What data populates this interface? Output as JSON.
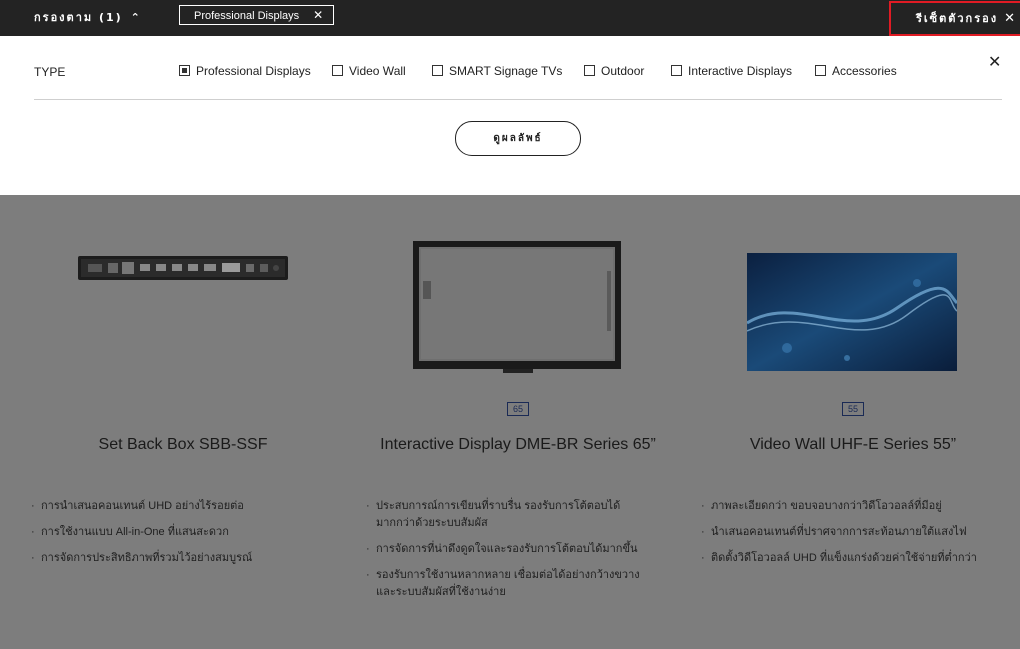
{
  "topbar": {
    "filter_toggle_label": "กรองตาม (1)",
    "active_chip_label": "Professional Displays",
    "reset_label": "รีเซ็ตตัวกรอง"
  },
  "filter": {
    "type_label": "TYPE",
    "options": [
      {
        "label": "Professional Displays",
        "checked": true
      },
      {
        "label": "Video Wall",
        "checked": false
      },
      {
        "label": "SMART Signage TVs",
        "checked": false
      },
      {
        "label": "Outdoor",
        "checked": false
      },
      {
        "label": "Interactive Displays",
        "checked": false
      },
      {
        "label": "Accessories",
        "checked": false
      }
    ],
    "view_results_label": "ดูผลลัพธ์"
  },
  "products": [
    {
      "title": "Set Back Box SBB-SSF",
      "size": "",
      "features": [
        "การนำเสนอคอนเทนต์ UHD อย่างไร้รอยต่อ",
        "การใช้งานแบบ All-in-One ที่แสนสะดวก",
        "การจัดการประสิทธิภาพที่รวมไว้อย่างสมบูรณ์"
      ]
    },
    {
      "title": "Interactive Display DME-BR Series 65”",
      "size": "65",
      "features": [
        "ประสบการณ์การเขียนที่ราบรื่น รองรับการโต้ตอบได้มากกว่าด้วยระบบสัมผัส",
        "การจัดการที่น่าดึงดูดใจและรองรับการโต้ตอบได้มากขึ้น",
        "รองรับการใช้งานหลากหลาย เชื่อมต่อได้อย่างกว้างขวาง และระบบสัมผัสที่ใช้งานง่าย"
      ]
    },
    {
      "title": "Video Wall UHF-E Series 55”",
      "size": "55",
      "features": [
        "ภาพละเอียดกว่า ขอบจอบางกว่าวิดีโอวอลล์ที่มีอยู่",
        "นำเสนอคอนเทนต์ที่ปราศจากการสะท้อนภายใต้แสงไฟ",
        "ติดตั้งวิดีโอวอลล์ UHD ที่แข็งแกร่งด้วยค่าใช้จ่ายที่ต่ำกว่า"
      ]
    }
  ],
  "colors": {
    "topbar_bg": "#232323",
    "reset_border": "#e01b24",
    "overlay_bg": "#7d7d7d"
  }
}
